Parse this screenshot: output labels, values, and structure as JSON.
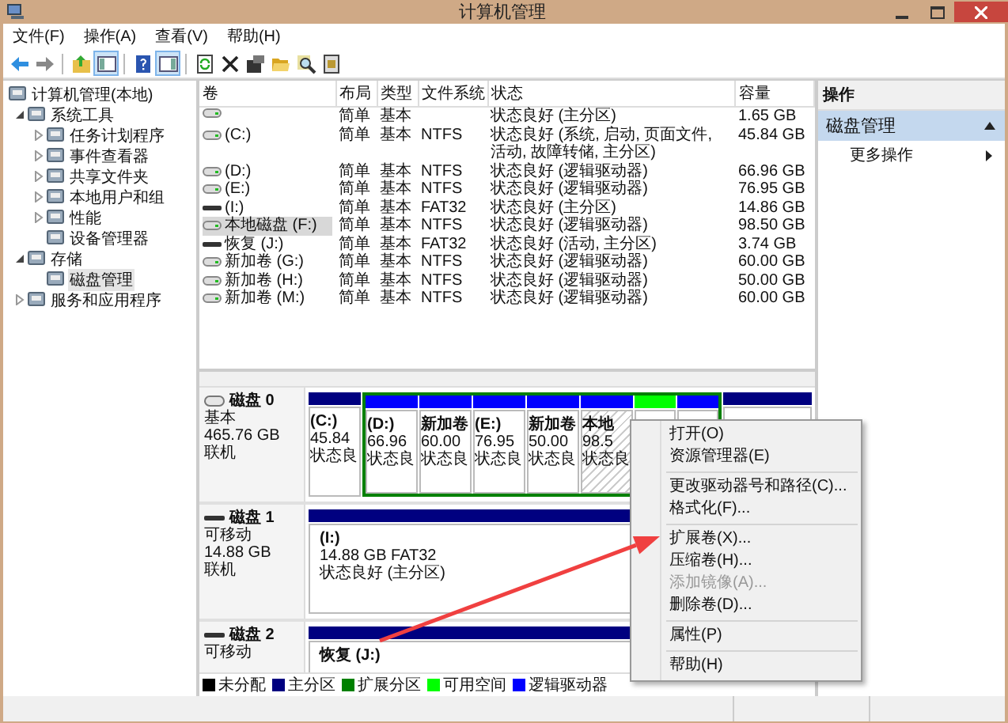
{
  "window": {
    "title": "计算机管理"
  },
  "menu_bar": [
    "文件(F)",
    "操作(A)",
    "查看(V)",
    "帮助(H)"
  ],
  "toolbar": [
    [
      {
        "kind": "back",
        "pressed": false
      },
      {
        "kind": "forward",
        "pressed": false
      }
    ],
    [
      {
        "kind": "up",
        "pressed": false
      },
      {
        "kind": "tree",
        "pressed": true
      }
    ],
    [
      {
        "kind": "help",
        "pressed": false
      },
      {
        "kind": "pane",
        "pressed": true
      }
    ],
    [
      {
        "kind": "refresh",
        "pressed": false
      },
      {
        "kind": "delete",
        "pressed": false
      },
      {
        "kind": "properties",
        "pressed": false
      },
      {
        "kind": "open",
        "pressed": false
      },
      {
        "kind": "search",
        "pressed": false
      },
      {
        "kind": "export",
        "pressed": false
      }
    ]
  ],
  "tree": [
    {
      "label": "计算机管理(本地)",
      "selected": false,
      "children": [
        {
          "label": "系统工具",
          "expanded": true,
          "selected": false,
          "children": [
            {
              "label": "任务计划程序",
              "expanded": false,
              "selected": false
            },
            {
              "label": "事件查看器",
              "expanded": false,
              "selected": false
            },
            {
              "label": "共享文件夹",
              "expanded": false,
              "selected": false
            },
            {
              "label": "本地用户和组",
              "expanded": false,
              "selected": false
            },
            {
              "label": "性能",
              "expanded": false,
              "selected": false
            },
            {
              "label": "设备管理器",
              "selected": false
            }
          ]
        },
        {
          "label": "存储",
          "expanded": true,
          "selected": false,
          "children": [
            {
              "label": "磁盘管理",
              "selected": true
            }
          ]
        },
        {
          "label": "服务和应用程序",
          "expanded": false,
          "selected": false
        }
      ]
    }
  ],
  "table": {
    "columns": [
      "卷",
      "布局",
      "类型",
      "文件系统",
      "状态",
      "容量"
    ],
    "rows": [
      {
        "kind": "fixed",
        "selected": false,
        "layout": "简单",
        "type": "基本",
        "status": "状态良好 (主分区)",
        "capacity": "1.65 GB"
      },
      {
        "kind": "fixed",
        "selected": false,
        "volume": "(C:)",
        "layout": "简单",
        "type": "基本",
        "file_system": "NTFS",
        "status": "状态良好 (系统, 启动, 页面文件, 活动, 故障转储, 主分区)",
        "capacity": "45.84 GB"
      },
      {
        "kind": "fixed",
        "selected": false,
        "volume": "(D:)",
        "layout": "简单",
        "type": "基本",
        "file_system": "NTFS",
        "status": "状态良好 (逻辑驱动器)",
        "capacity": "66.96 GB"
      },
      {
        "kind": "fixed",
        "selected": false,
        "volume": "(E:)",
        "layout": "简单",
        "type": "基本",
        "file_system": "NTFS",
        "status": "状态良好 (逻辑驱动器)",
        "capacity": "76.95 GB"
      },
      {
        "kind": "removable",
        "selected": false,
        "volume": "(I:)",
        "layout": "简单",
        "type": "基本",
        "file_system": "FAT32",
        "status": "状态良好 (主分区)",
        "capacity": "14.86 GB"
      },
      {
        "kind": "fixed",
        "selected": true,
        "volume": "本地磁盘 (F:)",
        "layout": "简单",
        "type": "基本",
        "file_system": "NTFS",
        "status": "状态良好 (逻辑驱动器)",
        "capacity": "98.50 GB"
      },
      {
        "kind": "removable",
        "selected": false,
        "volume": "恢复 (J:)",
        "layout": "简单",
        "type": "基本",
        "file_system": "FAT32",
        "status": "状态良好 (活动, 主分区)",
        "capacity": "3.74 GB"
      },
      {
        "kind": "fixed",
        "selected": false,
        "volume": "新加卷 (G:)",
        "layout": "简单",
        "type": "基本",
        "file_system": "NTFS",
        "status": "状态良好 (逻辑驱动器)",
        "capacity": "60.00 GB"
      },
      {
        "kind": "fixed",
        "selected": false,
        "volume": "新加卷 (H:)",
        "layout": "简单",
        "type": "基本",
        "file_system": "NTFS",
        "status": "状态良好 (逻辑驱动器)",
        "capacity": "50.00 GB"
      },
      {
        "kind": "fixed",
        "selected": false,
        "volume": "新加卷 (M:)",
        "layout": "简单",
        "type": "基本",
        "file_system": "NTFS",
        "status": "状态良好 (逻辑驱动器)",
        "capacity": "60.00 GB"
      }
    ]
  },
  "disks": [
    {
      "kind": "fixed",
      "name": "磁盘 0",
      "type": "基本",
      "size": "465.76 GB",
      "status": "联机",
      "partitions": [
        {
          "kind": "primary",
          "selected": false,
          "label": "(C:)",
          "size": "45.84",
          "status": "状态良"
        },
        {
          "kind": "extended",
          "children": [
            {
              "kind": "logical",
              "selected": false,
              "label": "(D:)",
              "size": "66.96",
              "status": "状态良"
            },
            {
              "kind": "logical",
              "selected": false,
              "label": "新加卷",
              "size": "60.00",
              "status": "状态良"
            },
            {
              "kind": "logical",
              "selected": false,
              "label": "(E:)",
              "size": "76.95",
              "status": "状态良"
            },
            {
              "kind": "logical",
              "selected": false,
              "label": "新加卷",
              "size": "50.00",
              "status": "状态良"
            },
            {
              "kind": "logical",
              "selected": true,
              "label": "本地",
              "size": "98.5",
              "status": "状态良"
            },
            {
              "kind": "free"
            },
            {
              "kind": "logical"
            }
          ]
        },
        {
          "kind": "primary"
        }
      ]
    },
    {
      "kind": "removable",
      "name": "磁盘 1",
      "type": "可移动",
      "size": "14.88 GB",
      "status": "联机",
      "partitions": [
        {
          "kind": "primary",
          "selected": false,
          "label": "(I:)",
          "size": "14.88 GB FAT32",
          "status": "状态良好 (主分区)"
        }
      ]
    },
    {
      "kind": "removable",
      "name": "磁盘 2",
      "type": "可移动",
      "partitions": [
        {
          "kind": "primary",
          "selected": false,
          "label": "恢复  (J:)"
        }
      ]
    }
  ],
  "legend": [
    {
      "label": "未分配",
      "color": "#000000"
    },
    {
      "label": "主分区",
      "color": "#000080"
    },
    {
      "label": "扩展分区",
      "color": "#008000"
    },
    {
      "label": "可用空间",
      "color": "#00ff00"
    },
    {
      "label": "逻辑驱动器",
      "color": "#0000ff"
    }
  ],
  "actions": {
    "title": "操作",
    "sections": [
      {
        "label": "磁盘管理",
        "selected": true,
        "items": [
          {
            "label": "更多操作"
          }
        ]
      }
    ]
  },
  "context_menu": [
    [
      {
        "label": "打开(O)",
        "disabled": false
      },
      {
        "label": "资源管理器(E)",
        "disabled": false
      }
    ],
    [
      {
        "label": "更改驱动器号和路径(C)...",
        "disabled": false
      },
      {
        "label": "格式化(F)...",
        "disabled": false
      }
    ],
    [
      {
        "label": "扩展卷(X)...",
        "disabled": false
      },
      {
        "label": "压缩卷(H)...",
        "disabled": false
      },
      {
        "label": "添加镜像(A)...",
        "disabled": true
      },
      {
        "label": "删除卷(D)...",
        "disabled": false
      }
    ],
    [
      {
        "label": "属性(P)",
        "disabled": false
      }
    ],
    [
      {
        "label": "帮助(H)",
        "disabled": false
      }
    ]
  ]
}
